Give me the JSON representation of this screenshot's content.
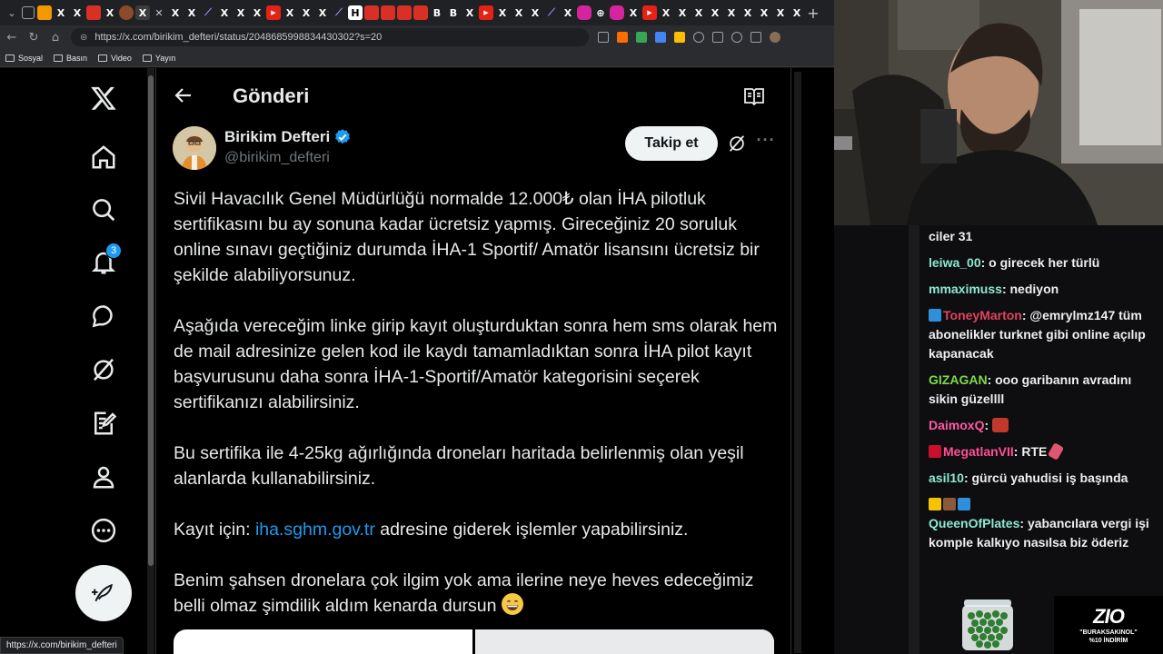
{
  "browser": {
    "url": "https://x.com/birikim_defteri/status/2048685998834430302?s=20",
    "bookmarks": [
      "Sosyal",
      "Basın",
      "Video",
      "Yayın"
    ],
    "status_url": "https://x.com/birikim_defteri"
  },
  "x": {
    "notification_count": "3",
    "page_title": "Gönderi",
    "author_name": "Birikim Defteri",
    "author_handle": "@birikim_defteri",
    "follow_label": "Takip et",
    "tweet": {
      "p1": "Sivil Havacılık Genel Müdürlüğü normalde 12.000₺ olan İHA pilotluk sertifikasını bu ay sonuna kadar ücretsiz yapmış. Gireceğiniz 20 soruluk online sınavı geçtiğiniz durumda İHA-1 Sportif/ Amatör lisansını ücretsiz bir şekilde alabiliyorsunuz.",
      "p2": "Aşağıda vereceğim linke girip kayıt oluşturduktan sonra hem sms olarak hem de mail adresinize gelen kod ile kaydı tamamladıktan sonra İHA pilot kayıt başvurusunu daha sonra İHA-1-Sportif/Amatör kategorisini seçerek sertifikanızı alabilirsiniz.",
      "p3": "Bu sertifika ile 4-25kg ağırlığında droneları haritada belirlenmiş olan yeşil alanlarda kullanabilirsiniz.",
      "p4_prefix": "Kayıt için: ",
      "p4_link": "iha.sghm.gov.tr",
      "p4_suffix": " adresine giderek işlemler yapabilirsiniz.",
      "p5": "Benim şahsen dronelara çok ilgim yok ama ilerine neye heves edeceğimiz belli olmaz şimdilik aldım kenarda dursun"
    }
  },
  "chat": {
    "messages": [
      {
        "user": "",
        "text": "ciler 31",
        "color": "#efeff1"
      },
      {
        "user": "leiwa_00",
        "text": "o girecek her türlü",
        "color": "#8be9d0"
      },
      {
        "user": "mmaximuss",
        "text": "nediyon",
        "color": "#8be9d0"
      },
      {
        "user": "ToneyMarton",
        "text": "@emrylmz147 tüm abonelikler turknet gibi online açılıp kapanacak",
        "color": "#e0445c"
      },
      {
        "user": "GIZAGAN",
        "text": "ooo garibanın avradını sikin güzellll",
        "color": "#7cdc49"
      },
      {
        "user": "DaimoxQ",
        "text": "",
        "color": "#ff5aa0"
      },
      {
        "user": "MegatlanVII",
        "text": "RTE",
        "color": "#ff4f93"
      },
      {
        "user": "asil10",
        "text": "gürcü yahudisi iş başında",
        "color": "#8be9d0"
      },
      {
        "user": "QueenOfPlates",
        "text": "yabancılara vergi işi komple kalkıyo nasılsa biz öderiz",
        "color": "#8be9d0"
      }
    ]
  },
  "promo": {
    "logo": "ZIO",
    "line1": "\"BURAKSAKINOL\"",
    "line2": "%10 İNDİRİM"
  },
  "colors": {
    "x_bg": "#000000",
    "x_text": "#e7e9ea",
    "x_muted": "#71767b",
    "x_link": "#1d9bf0",
    "chrome_bg": "#202124"
  }
}
